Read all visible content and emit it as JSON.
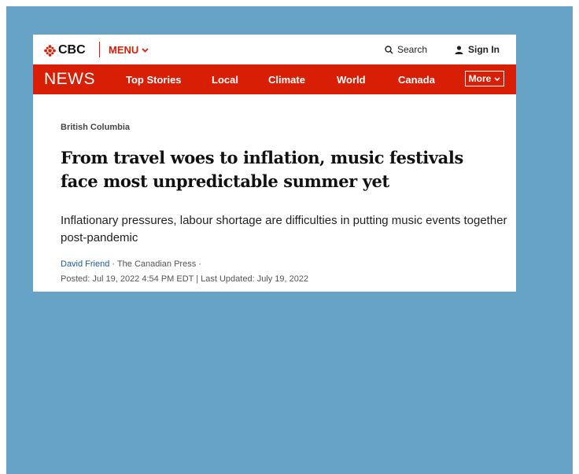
{
  "header": {
    "logo_text": "CBC",
    "menu_label": "MENU",
    "search_label": "Search",
    "signin_label": "Sign In"
  },
  "nav": {
    "section_label": "NEWS",
    "items": [
      "Top Stories",
      "Local",
      "Climate",
      "World",
      "Canada"
    ],
    "more_label": "More"
  },
  "article": {
    "section": "British Columbia",
    "headline": "From travel woes to inflation, music festivals face most unpredictable summer yet",
    "deck": "Inflationary pressures, labour shortage are difficulties in putting music events together post-pandemic",
    "author": "David Friend",
    "source": " · The Canadian Press ·",
    "dates": "Posted: Jul 19, 2022 4:54 PM EDT | Last Updated: July 19, 2022"
  },
  "colors": {
    "brand_red": "#d81e05",
    "background": "#67a3c7",
    "link_blue": "#1d5aab"
  },
  "icons": [
    "cbc-gem-icon",
    "chevron-down-icon",
    "search-icon",
    "user-icon"
  ]
}
